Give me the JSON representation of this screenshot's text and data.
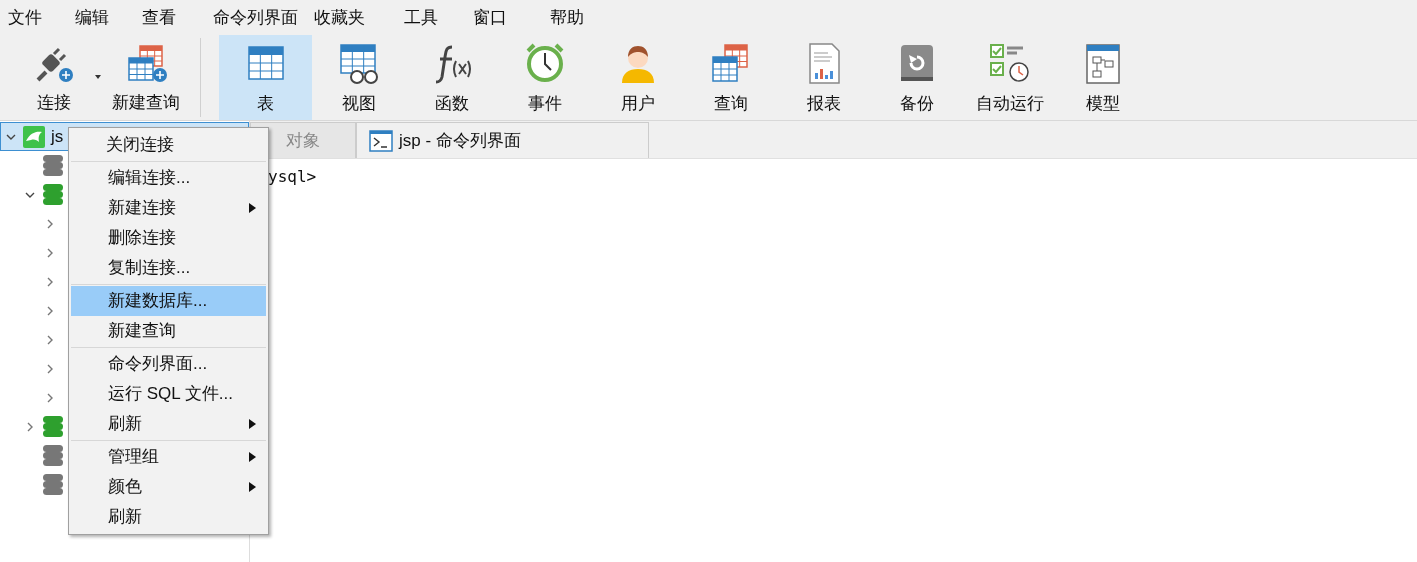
{
  "menubar": [
    "文件",
    "编辑",
    "查看",
    "命令列界面",
    "收藏夹",
    "工具",
    "窗口",
    "帮助"
  ],
  "toolbar": {
    "left": [
      {
        "label": "连接",
        "dropdown": true
      },
      {
        "label": "新建查询",
        "dropdown": false
      }
    ],
    "main": [
      {
        "label": "表",
        "selected": true
      },
      {
        "label": "视图",
        "selected": false
      },
      {
        "label": "函数",
        "selected": false
      },
      {
        "label": "事件",
        "selected": false
      },
      {
        "label": "用户",
        "selected": false
      },
      {
        "label": "查询",
        "selected": false
      },
      {
        "label": "报表",
        "selected": false
      },
      {
        "label": "备份",
        "selected": false
      },
      {
        "label": "自动运行",
        "selected": false
      },
      {
        "label": "模型",
        "selected": false
      }
    ]
  },
  "tree": [
    {
      "label": "js",
      "selected": true,
      "expanded": true,
      "children": [
        {
          "open": false
        },
        {
          "open": true,
          "expanded": true,
          "children": [
            {
              "expanded": false
            },
            {
              "expanded": false
            },
            {
              "expanded": false
            },
            {
              "expanded": false
            },
            {
              "expanded": false
            },
            {
              "expanded": false
            },
            {
              "expanded": false
            }
          ]
        },
        {
          "open": true,
          "expanded": false
        },
        {
          "open": false
        },
        {
          "open": false
        }
      ]
    }
  ],
  "tabs": [
    {
      "label": "对象",
      "selected": false
    },
    {
      "label": "jsp - 命令列界面",
      "selected": true
    }
  ],
  "console": {
    "text": "ysql>"
  },
  "context_menu": {
    "groups": [
      [
        {
          "label": "关闭连接",
          "submenu": false,
          "selected": false
        }
      ],
      [
        {
          "label": "编辑连接...",
          "submenu": false,
          "selected": false
        },
        {
          "label": "新建连接",
          "submenu": true,
          "selected": false
        },
        {
          "label": "删除连接",
          "submenu": false,
          "selected": false
        },
        {
          "label": "复制连接...",
          "submenu": false,
          "selected": false
        }
      ],
      [
        {
          "label": "新建数据库...",
          "submenu": false,
          "selected": true
        },
        {
          "label": "新建查询",
          "submenu": false,
          "selected": false
        }
      ],
      [
        {
          "label": "命令列界面...",
          "submenu": false,
          "selected": false
        },
        {
          "label": "运行 SQL 文件...",
          "submenu": false,
          "selected": false
        },
        {
          "label": "刷新",
          "submenu": true,
          "selected": false
        }
      ],
      [
        {
          "label": "管理组",
          "submenu": true,
          "selected": false
        },
        {
          "label": "颜色",
          "submenu": true,
          "selected": false
        },
        {
          "label": "刷新",
          "submenu": false,
          "selected": false
        }
      ]
    ]
  }
}
